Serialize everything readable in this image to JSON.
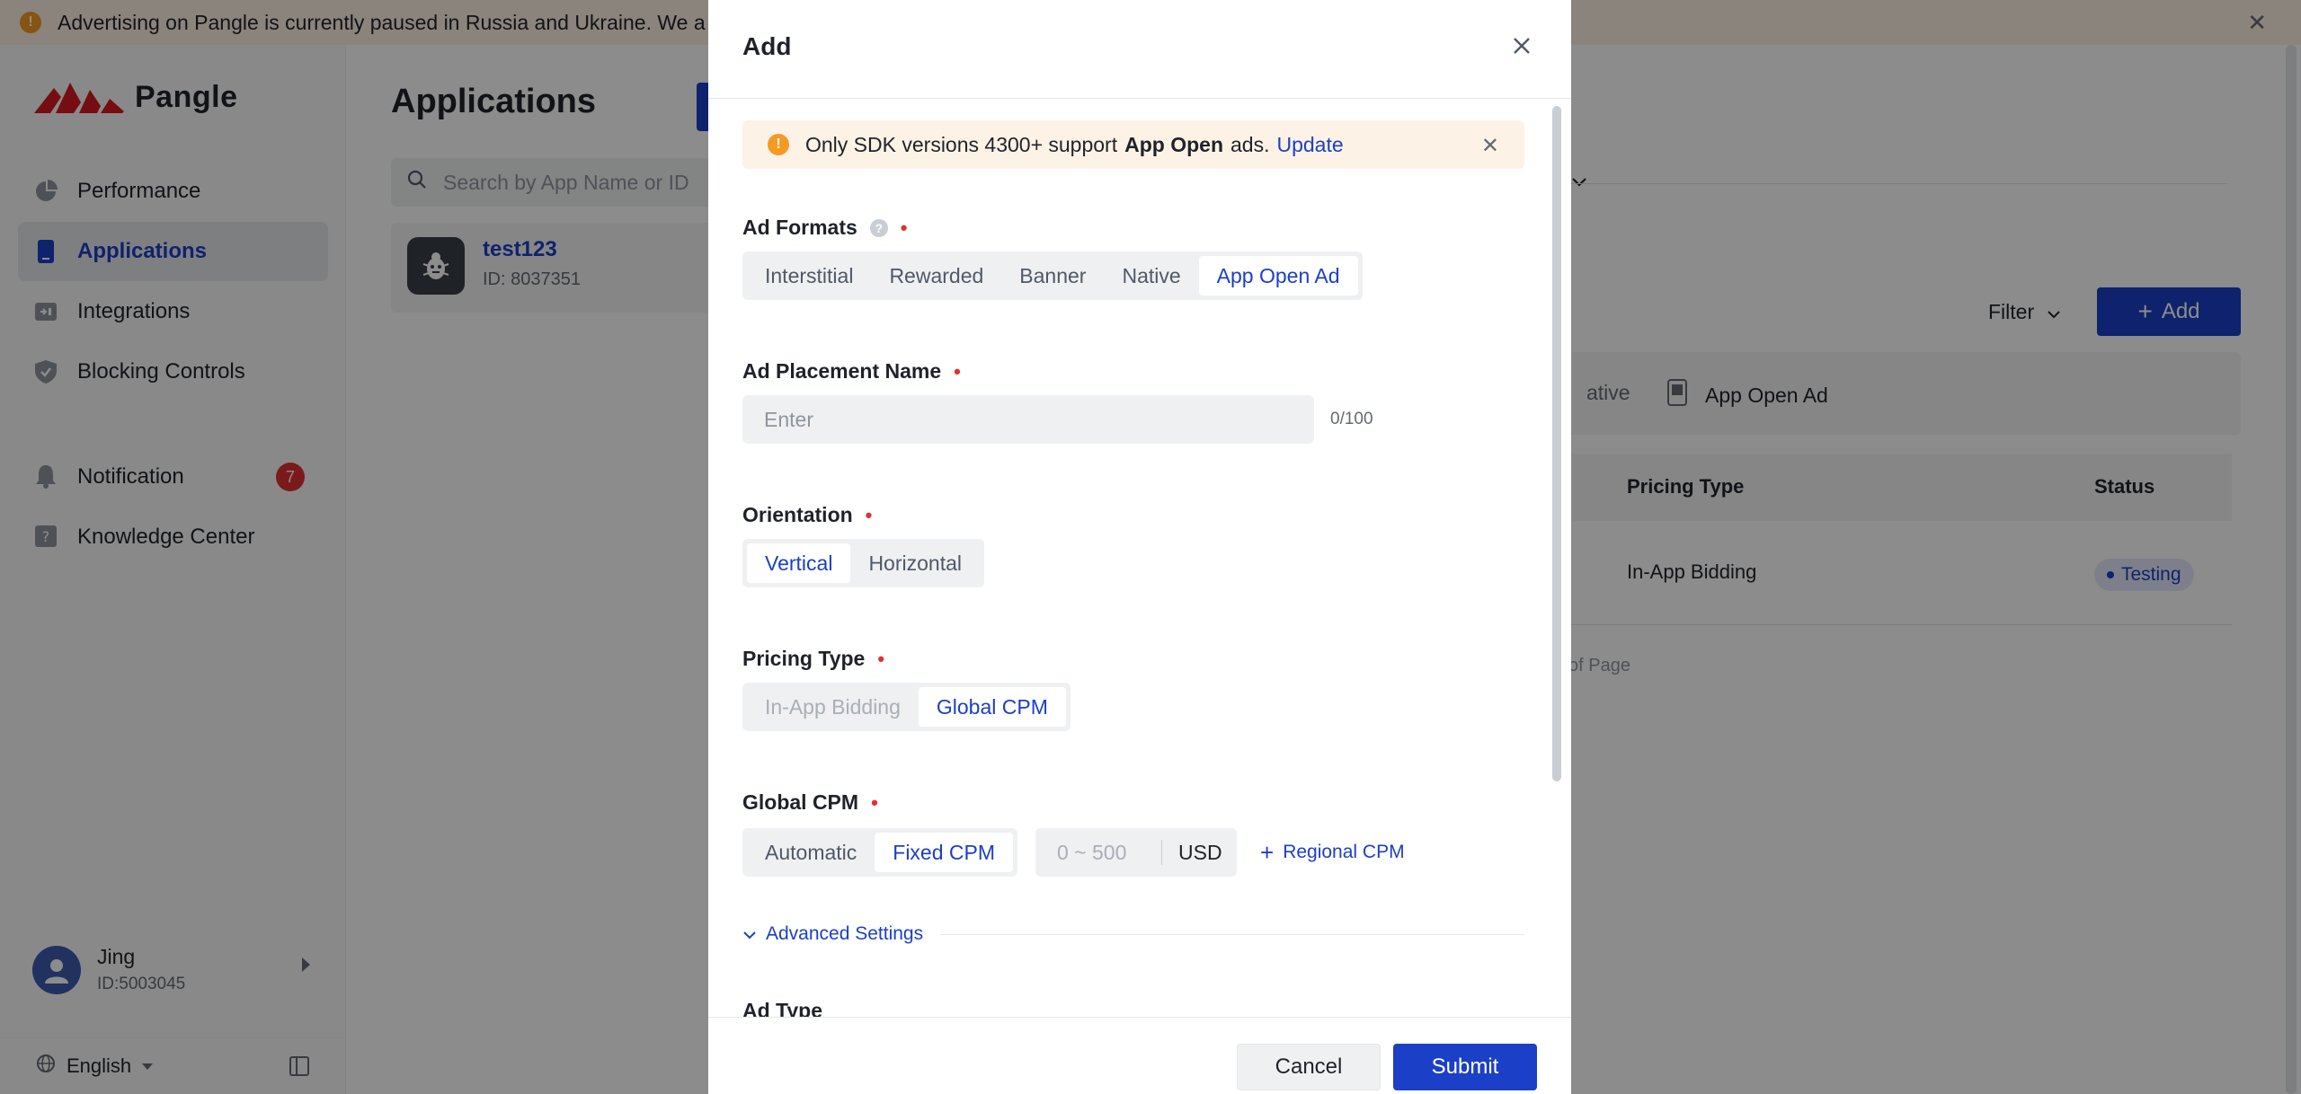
{
  "banner": {
    "text": "Advertising on Pangle is currently paused in Russia and Ukraine. We a"
  },
  "sidebar": {
    "logo": "Pangle",
    "items": [
      {
        "label": "Performance",
        "icon": "pie-chart-icon"
      },
      {
        "label": "Applications",
        "icon": "phone-icon"
      },
      {
        "label": "Integrations",
        "icon": "integration-icon"
      },
      {
        "label": "Blocking Controls",
        "icon": "shield-icon"
      },
      {
        "label": "Notification",
        "icon": "bell-icon",
        "badge": "7"
      },
      {
        "label": "Knowledge Center",
        "icon": "help-book-icon"
      }
    ],
    "user": {
      "name": "Jing",
      "id": "ID:5003045"
    },
    "language": "English"
  },
  "main": {
    "title": "Applications",
    "search_placeholder": "Search by App Name or ID",
    "app": {
      "name": "test123",
      "id": "ID: 8037351"
    },
    "filter_label": "Filter",
    "add_label": "Add",
    "format_strip": {
      "partial": "ative",
      "app_open": "App Open Ad"
    },
    "table": {
      "headers": {
        "pricing": "Pricing Type",
        "status": "Status"
      },
      "row": {
        "pricing": "In-App Bidding",
        "status": "Testing"
      }
    },
    "pagination_partial": "of Page"
  },
  "modal": {
    "title": "Add",
    "notice": {
      "prefix": "Only SDK versions 4300+ support",
      "bold": "App Open",
      "suffix": "ads.",
      "link": "Update"
    },
    "ad_formats": {
      "label": "Ad Formats",
      "options": [
        "Interstitial",
        "Rewarded",
        "Banner",
        "Native",
        "App Open Ad"
      ],
      "selected": "App Open Ad"
    },
    "placement_name": {
      "label": "Ad Placement Name",
      "placeholder": "Enter",
      "counter": "0/100"
    },
    "orientation": {
      "label": "Orientation",
      "options": [
        "Vertical",
        "Horizontal"
      ],
      "selected": "Vertical"
    },
    "pricing_type": {
      "label": "Pricing Type",
      "options": [
        "In-App Bidding",
        "Global CPM"
      ],
      "selected": "Global CPM"
    },
    "global_cpm": {
      "label": "Global CPM",
      "options": [
        "Automatic",
        "Fixed CPM"
      ],
      "selected": "Fixed CPM",
      "placeholder": "0 ~ 500",
      "unit": "USD",
      "regional": "Regional CPM"
    },
    "advanced": "Advanced Settings",
    "ad_type_label": "Ad Type",
    "cancel": "Cancel",
    "submit": "Submit"
  },
  "colors": {
    "brand": "#1b3fc7",
    "required": "#e03131",
    "warning": "#f59a23"
  }
}
